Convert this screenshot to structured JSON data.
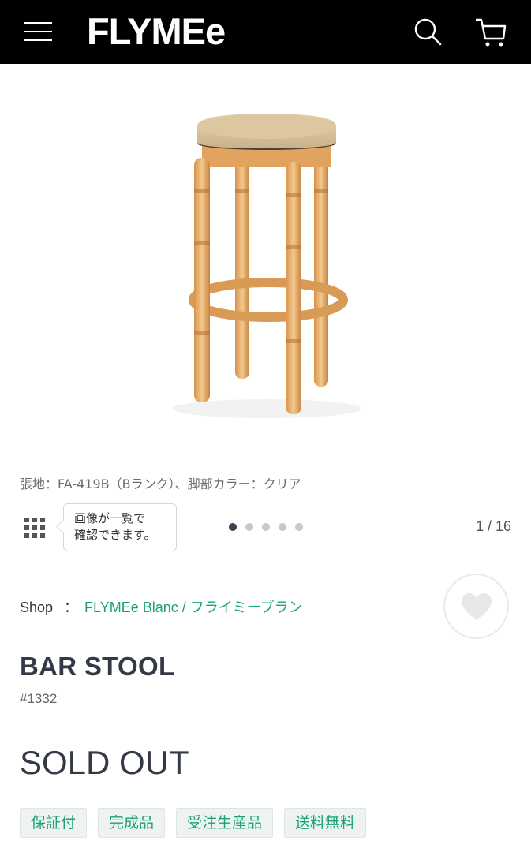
{
  "header": {
    "logo": "FLYMEe",
    "menu_icon": "hamburger-menu-icon",
    "search_icon": "search-icon",
    "cart_icon": "cart-icon"
  },
  "product": {
    "image_alt": "bar stool",
    "caption": "張地：FA-419B（Bランク）、脚部カラー：クリア",
    "gallery_tooltip_line1": "画像が一覧で",
    "gallery_tooltip_line2": "確認できます。",
    "gallery_counter": "1 / 16",
    "gallery_current": 1,
    "gallery_dots": 5,
    "shop_label": "Shop",
    "shop_sep": "：",
    "shop_name": "FLYMEe Blanc / フライミーブラン",
    "title": "BAR STOOL",
    "code": "#1332",
    "status": "SOLD OUT",
    "tags": [
      "保証付",
      "完成品",
      "受注生産品",
      "送料無料"
    ]
  },
  "colors": {
    "header_bg": "#000000",
    "accent": "#1aa176",
    "text_dark": "#333a46"
  }
}
